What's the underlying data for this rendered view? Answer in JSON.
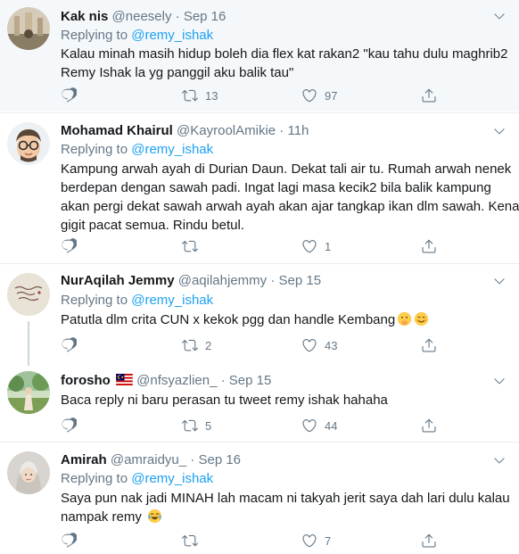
{
  "tweets": [
    {
      "name": "Kak nis",
      "handle": "@neesely",
      "dot": "·",
      "time": "Sep 16",
      "replying_prefix": "Replying to",
      "mention": "@remy_ishak",
      "lines": [
        "Kalau minah masih hidup boleh dia flex kat rakan2 \"kau tahu dulu maghrib2",
        "Remy Ishak la yg panggil aku balik tau\""
      ],
      "retweets": "13",
      "likes": "97",
      "replies": ""
    },
    {
      "name": "Mohamad Khairul",
      "handle": "@KayroolAmikie",
      "dot": "·",
      "time": "11h",
      "replying_prefix": "Replying to",
      "mention": "@remy_ishak",
      "lines": [
        "Kampung arwah ayah di Durian Daun. Dekat tali air tu. Rumah arwah nenek",
        "berdepan dengan sawah padi. Ingat lagi masa kecik2 bila balik kampung",
        "akan pergi dekat sawah arwah ayah akan ajar tangkap ikan dlm sawah. Kena",
        "gigit pacat semua. Rindu betul."
      ],
      "retweets": "",
      "likes": "1",
      "replies": ""
    },
    {
      "name": "NurAqilah Jemmy",
      "handle": "@aqilahjemmy",
      "dot": "·",
      "time": "Sep 15",
      "replying_prefix": "Replying to",
      "mention": "@remy_ishak",
      "lines": [
        "Patutla dlm crita CUN x kekok pgg dan handle  Kembang"
      ],
      "retweets": "2",
      "likes": "43",
      "replies": ""
    },
    {
      "name": "forosho",
      "handle": "@nfsyazlien_",
      "dot": "·",
      "time": "Sep 15",
      "lines": [
        "Baca reply ni baru perasan tu tweet remy ishak hahaha"
      ],
      "retweets": "5",
      "likes": "44",
      "replies": ""
    },
    {
      "name": "Amirah",
      "handle": "@amraidyu_",
      "dot": "·",
      "time": "Sep 16",
      "replying_prefix": "Replying to",
      "mention": "@remy_ishak",
      "lines": [
        "Saya pun nak jadi MINAH lah macam ni takyah jerit saya dah lari dulu kalau",
        "nampak remy"
      ],
      "retweets": "",
      "likes": "7",
      "replies": ""
    }
  ],
  "colors": {
    "accent": "#1da1f2",
    "muted": "#657786",
    "text": "#14171a",
    "border": "#e6ecf0",
    "highlight_bg": "#f5f8fa"
  },
  "icons": [
    "reply-icon",
    "retweet-icon",
    "like-icon",
    "share-icon",
    "caret-down-icon",
    "malaysia-flag-icon",
    "hand-over-mouth-emoji",
    "smiling-face-emoji",
    "tears-of-joy-emoji"
  ]
}
